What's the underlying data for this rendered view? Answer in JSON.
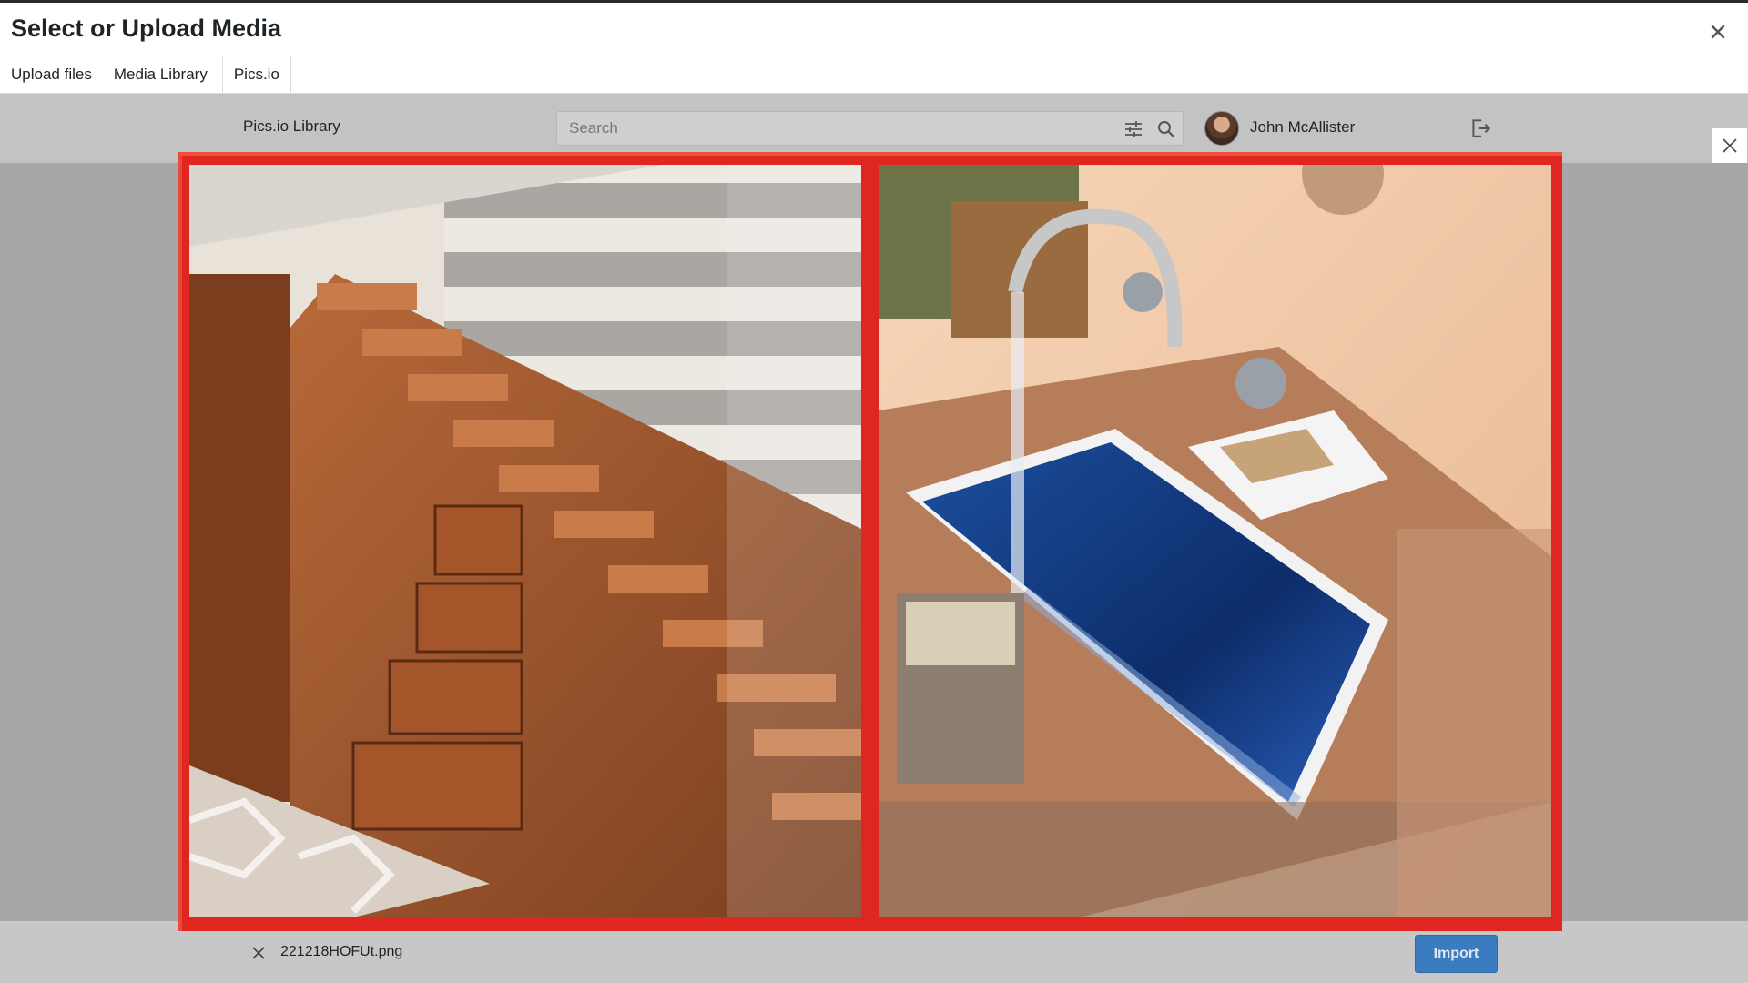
{
  "modal": {
    "title": "Select or Upload Media",
    "close_icon": "close-icon"
  },
  "tabs": [
    {
      "label": "Upload files"
    },
    {
      "label": "Media Library"
    },
    {
      "label": "Pics.io",
      "active": true
    }
  ],
  "picsio": {
    "library_title": "Pics.io Library",
    "search": {
      "placeholder": "Search",
      "value": ""
    },
    "filter_icon": "sliders-icon",
    "search_icon": "search-icon",
    "user": {
      "name": "John McAllister",
      "avatar_icon": "user-avatar"
    },
    "logout_icon": "logout-icon"
  },
  "preview": {
    "close_icon": "close-icon",
    "frame_color": "#e02620",
    "images": [
      {
        "subject": "wooden staircase with built-in drawers"
      },
      {
        "subject": "blue resin sink with faucet"
      }
    ]
  },
  "footer": {
    "file_name": "221218HOFUt.png",
    "remove_icon": "close-icon",
    "import_label": "Import",
    "import_color": "#3b7bbf"
  }
}
